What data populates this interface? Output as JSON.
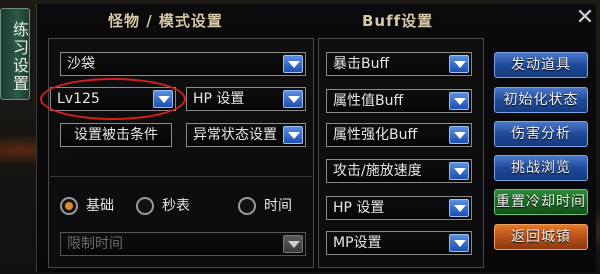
{
  "side_tab": {
    "label": "练习设置"
  },
  "header": {
    "monster_title": "怪物 / 模式设置",
    "buff_title": "Buff设置",
    "close_glyph": "✕"
  },
  "monster": {
    "monster_select": "沙袋",
    "level_select": "Lv125",
    "hp_select": "HP 设置",
    "hit_condition_button": "设置被击条件",
    "status_select": "异常状态设置",
    "modes": [
      {
        "label": "基础",
        "checked": true
      },
      {
        "label": "秒表",
        "checked": false
      },
      {
        "label": "时间",
        "checked": false
      }
    ],
    "time_limit_select": "限制时间"
  },
  "buff": {
    "selects": [
      "暴击Buff",
      "属性值Buff",
      "属性强化Buff",
      "攻击/施放速度",
      "HP 设置",
      "MP设置"
    ]
  },
  "actions": [
    {
      "label": "发动道具",
      "style": "blue"
    },
    {
      "label": "初始化状态",
      "style": "blue"
    },
    {
      "label": "伤害分析",
      "style": "blue"
    },
    {
      "label": "挑战浏览",
      "style": "blue"
    },
    {
      "label": "重置冷却时间",
      "style": "green"
    },
    {
      "label": "返回城镇",
      "style": "orange"
    }
  ],
  "colors": {
    "accent_blue": "#1f4a9a",
    "accent_green": "#1a6a24",
    "accent_orange": "#b8501a",
    "highlight_red": "#d41f1f",
    "radio_checked": "#e08a2a"
  }
}
